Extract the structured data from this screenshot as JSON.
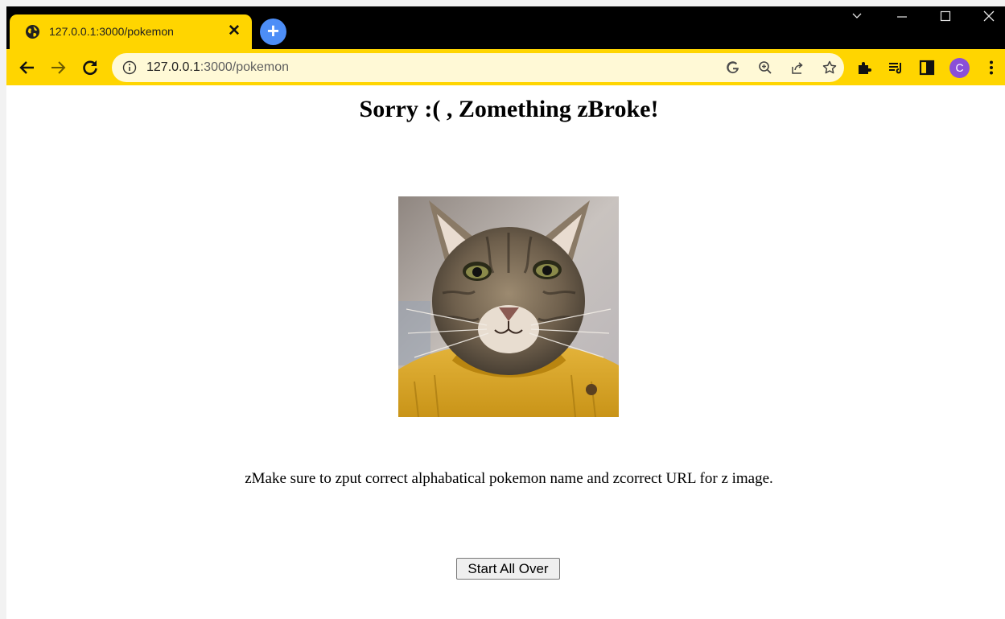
{
  "tab": {
    "title": "127.0.0.1:3000/pokemon",
    "close_glyph": "✕",
    "new_tab_glyph": "+"
  },
  "toolbar": {
    "url_host": "127.0.0.1",
    "url_rest": ":3000/pokemon",
    "profile_initial": "C"
  },
  "page": {
    "heading": "Sorry :( , Zomething zBroke!",
    "message": "zMake sure to zput correct alphabatical pokemon name and zcorrect URL for z image.",
    "button_label": "Start All Over"
  },
  "colors": {
    "theme_yellow": "#ffd500",
    "tabstrip_black": "#000000",
    "new_tab_blue": "#4d8ef7",
    "profile_purple": "#8a4fd8"
  },
  "icons": {
    "favicon": "globe-icon",
    "back": "arrow-left-icon",
    "forward": "arrow-right-icon",
    "reload": "reload-icon",
    "info": "info-icon",
    "google": "google-icon",
    "zoom": "zoom-icon",
    "share": "share-icon",
    "bookmark": "star-icon",
    "extensions": "puzzle-icon",
    "reading_list": "reading-list-icon",
    "side_panel": "side-panel-icon",
    "menu": "kebab-menu-icon"
  }
}
